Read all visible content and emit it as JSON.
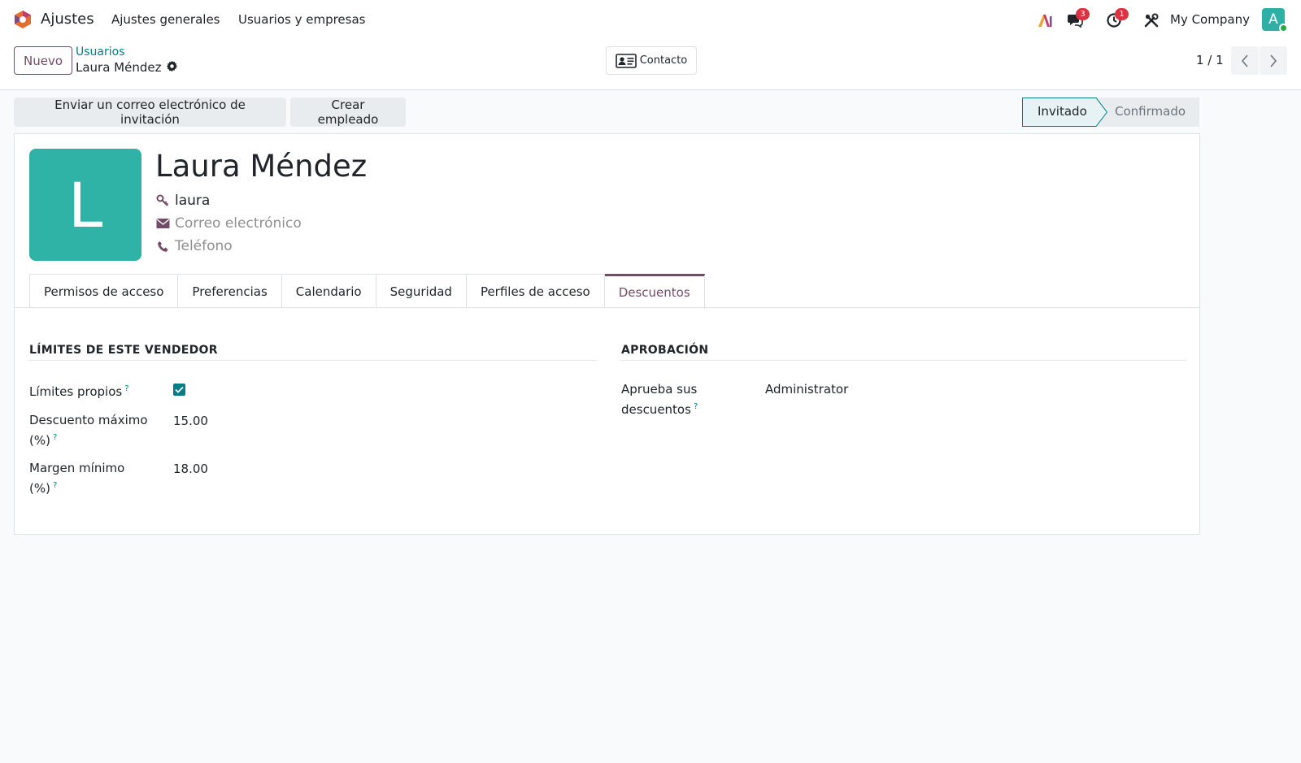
{
  "navbar": {
    "app_name": "Ajustes",
    "menu": [
      "Ajustes generales",
      "Usuarios y empresas"
    ],
    "messages_count": "3",
    "activities_count": "1",
    "company": "My Company",
    "avatar_letter": "A"
  },
  "control_panel": {
    "new_label": "Nuevo",
    "breadcrumb_parent": "Usuarios",
    "breadcrumb_current": "Laura Méndez",
    "contact_label": "Contacto",
    "pager": "1 / 1"
  },
  "statusbar": {
    "actions": [
      "Enviar un correo electrónico de invitación",
      "Crear empleado"
    ],
    "stages": [
      "Invitado",
      "Confirmado"
    ]
  },
  "form": {
    "avatar_letter": "L",
    "name": "Laura Méndez",
    "login": "laura",
    "email_placeholder": "Correo electrónico",
    "phone_placeholder": "Teléfono",
    "tabs": [
      "Permisos de acceso",
      "Preferencias",
      "Calendario",
      "Seguridad",
      "Perfiles de acceso",
      "Descuentos"
    ],
    "limits": {
      "title": "LÍMITES DE ESTE VENDEDOR",
      "own_limits_label": "Límites propios",
      "own_limits_checked": true,
      "max_discount_label_1": "Descuento máximo",
      "max_discount_label_2": "(%)",
      "max_discount_value": "15.00",
      "min_margin_label_1": "Margen mínimo",
      "min_margin_label_2": "(%)",
      "min_margin_value": "18.00"
    },
    "approval": {
      "title": "APROBACIÓN",
      "approver_label_1": "Aprueba sus",
      "approver_label_2": "descuentos",
      "approver_value": "Administrator"
    },
    "help_mark": "?"
  },
  "colors": {
    "brand": "#714b67",
    "link": "#017e84",
    "avatar": "#2eb3a6"
  }
}
